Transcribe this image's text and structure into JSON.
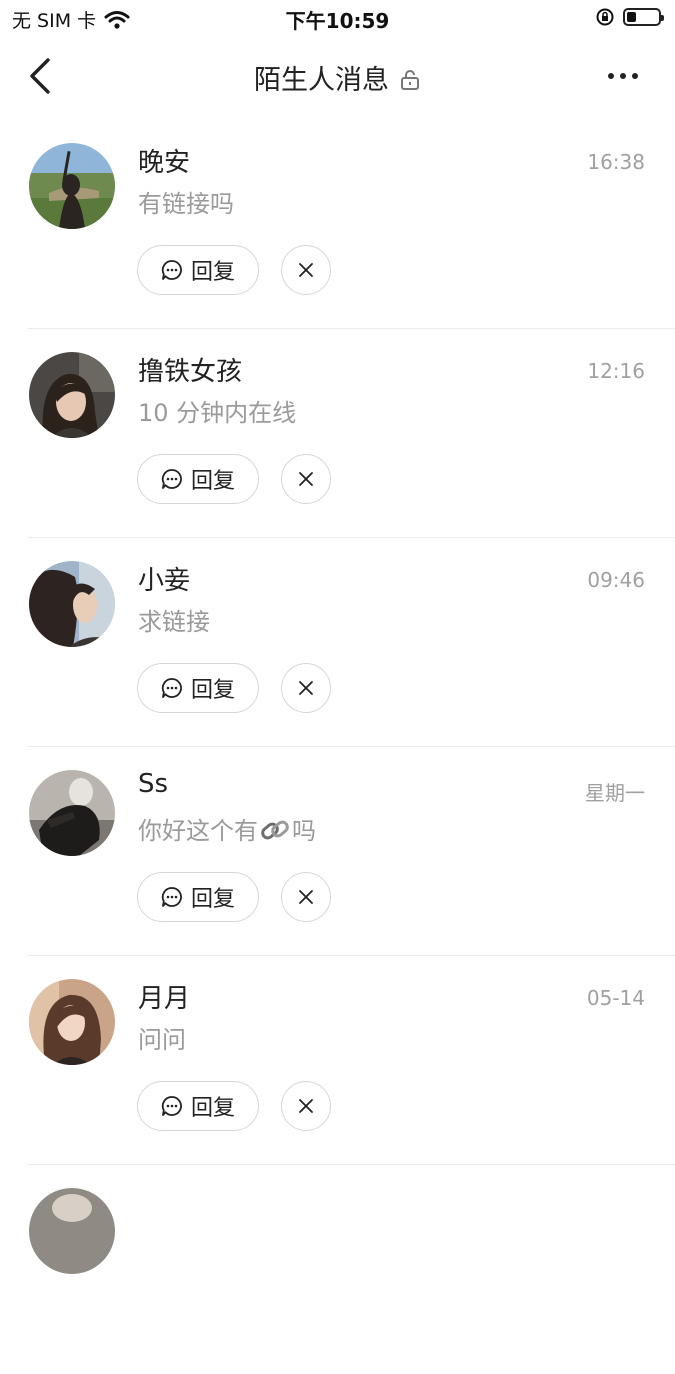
{
  "status_bar": {
    "carrier": "无 SIM 卡",
    "time": "下午10:59",
    "battery_level": 0.3
  },
  "nav": {
    "title": "陌生人消息"
  },
  "actions": {
    "reply_label": "回复"
  },
  "colors": {
    "text_primary": "#222222",
    "text_secondary": "#9a9a9a",
    "divider": "#ebebeb",
    "button_border": "#d6d6d6"
  },
  "messages": [
    {
      "name": "晚安",
      "preview": "有链接吗",
      "time": "16:38"
    },
    {
      "name": "撸铁女孩",
      "preview": "10 分钟内在线",
      "time": "12:16"
    },
    {
      "name": "小妾",
      "preview": "求链接",
      "time": "09:46"
    },
    {
      "name": "Ss",
      "preview_before": "你好这个有",
      "preview_emoji": "link-emoji",
      "preview_after": "吗",
      "time": "星期一"
    },
    {
      "name": "月月",
      "preview": "问问",
      "time": "05-14"
    }
  ]
}
